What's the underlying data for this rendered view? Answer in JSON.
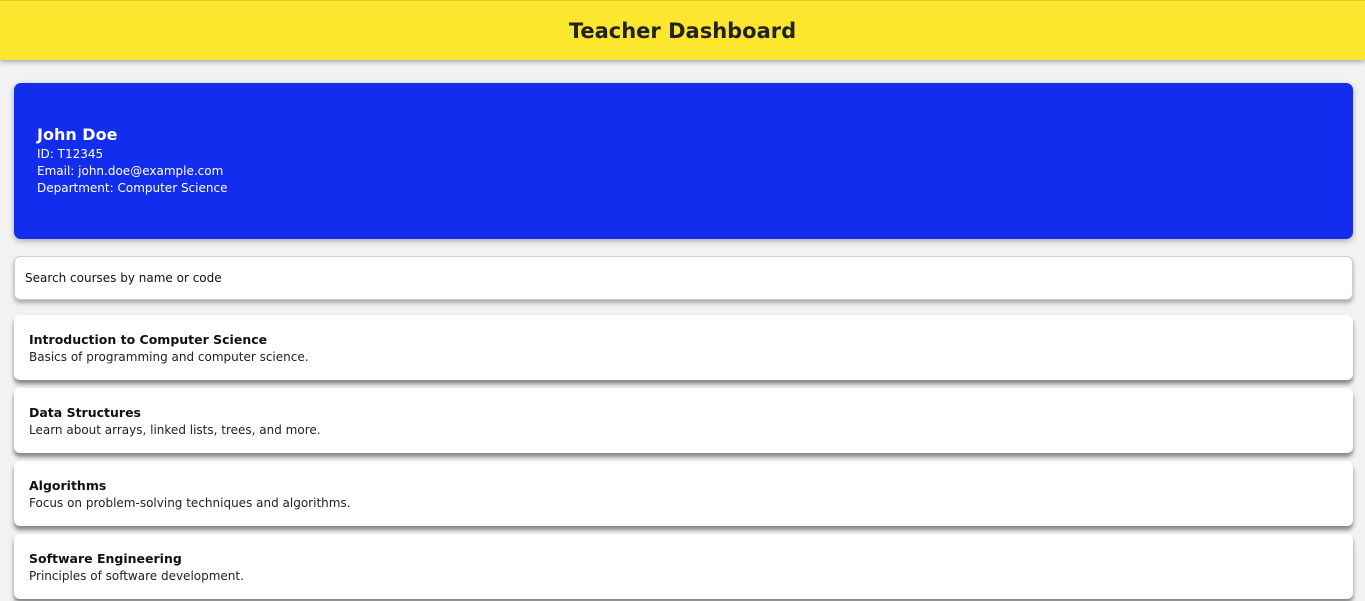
{
  "header": {
    "title": "Teacher Dashboard"
  },
  "profile": {
    "name": "John Doe",
    "id": "ID: T12345",
    "email": "Email: john.doe@example.com",
    "department": "Department: Computer Science"
  },
  "search": {
    "placeholder": "Search courses by name or code"
  },
  "courses": [
    {
      "title": "Introduction to Computer Science",
      "description": "Basics of programming and computer science."
    },
    {
      "title": "Data Structures",
      "description": "Learn about arrays, linked lists, trees, and more."
    },
    {
      "title": "Algorithms",
      "description": "Focus on problem-solving techniques and algorithms."
    },
    {
      "title": "Software Engineering",
      "description": "Principles of software development."
    }
  ]
}
